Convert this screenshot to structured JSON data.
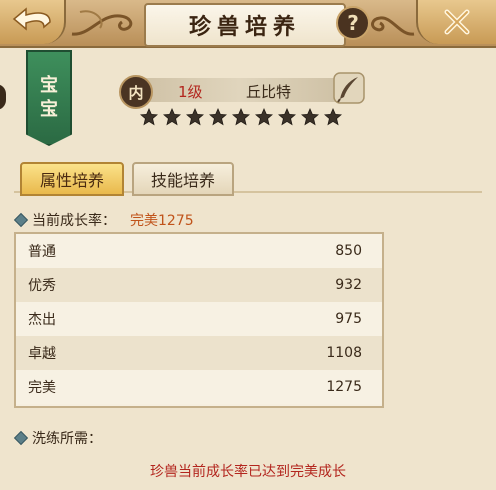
{
  "header": {
    "title": "珍兽培养",
    "help_label": "?"
  },
  "pet": {
    "rank_chars": [
      "宝",
      "宝"
    ],
    "seal_char": "内",
    "level": "1级",
    "name": "丘比特",
    "stars": 9
  },
  "tabs": [
    {
      "label": "属性培养",
      "active": true
    },
    {
      "label": "技能培养",
      "active": false
    }
  ],
  "growth": {
    "label": "当前成长率：",
    "current": "完美1275",
    "rows": [
      {
        "name": "普通",
        "value": "850"
      },
      {
        "name": "优秀",
        "value": "932"
      },
      {
        "name": "杰出",
        "value": "975"
      },
      {
        "name": "卓越",
        "value": "1108"
      },
      {
        "name": "完美",
        "value": "1275"
      }
    ]
  },
  "refine": {
    "label": "洗练所需："
  },
  "notice": "珍兽当前成长率已达到完美成长",
  "colors": {
    "accent": "#c0531a",
    "warning": "#b3261e",
    "tab_active": "#e9b94c",
    "rank_tag": "#2b6a43"
  }
}
